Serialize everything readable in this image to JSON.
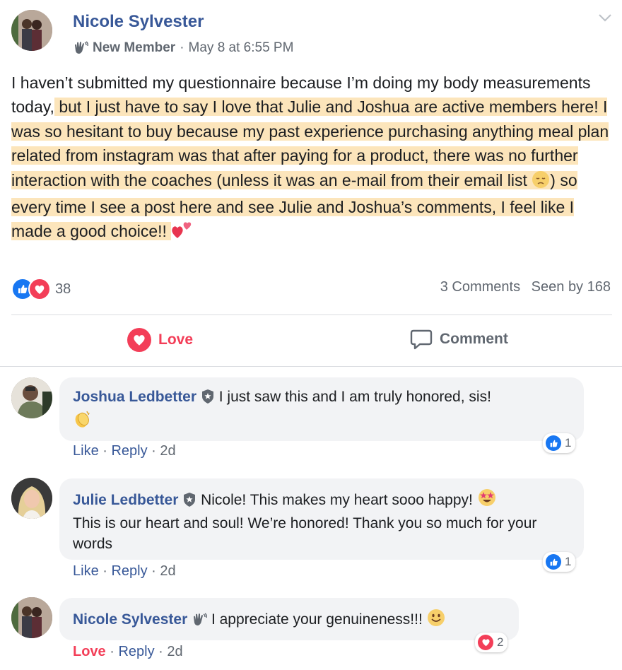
{
  "post": {
    "author": "Nicole Sylvester",
    "badge": "New Member",
    "separator": "·",
    "time": "May 8 at 6:55 PM",
    "text_plain_1": "I haven’t submitted my questionnaire because I’m doing my body measurements today,",
    "text_highlight_1": " but I just have to say I love that Julie and Joshua are active members here! I was so hesitant to buy because my past experience purchasing anything meal plan related from instagram was that after paying for a product, there was no further interaction with the coaches (unless it was an e-mail from their email list ",
    "text_highlight_2": ") so every time I see a post here and see Julie and Joshua’s comments, I feel like I made a good choice!! ",
    "reaction_count": "38",
    "comments_count": "3 Comments",
    "seen_by": "Seen by 168",
    "love_label": "Love",
    "comment_label": "Comment"
  },
  "comments": [
    {
      "author": "Joshua Ledbetter",
      "text": "I just saw this and I am truly honored, sis!",
      "action_like": "Like",
      "action_reply": "Reply",
      "time": "2d",
      "reaction_count": "1"
    },
    {
      "author": "Julie Ledbetter",
      "text": "Nicole! This makes my heart sooo happy! ",
      "text_2": "This is our heart and soul! We’re honored! Thank you so much for your words",
      "action_like": "Like",
      "action_reply": "Reply",
      "time": "2d",
      "reaction_count": "1"
    },
    {
      "author": "Nicole Sylvester",
      "text": "I appreciate your genuineness!!! ",
      "action_like": "Love",
      "action_reply": "Reply",
      "time": "2d",
      "reaction_count": "2"
    }
  ],
  "colors": {
    "author_blue": "#385898",
    "love_red": "#f33e58",
    "like_blue": "#1877f2",
    "highlight": "#fce5bb",
    "bubble_gray": "#f2f3f5"
  }
}
